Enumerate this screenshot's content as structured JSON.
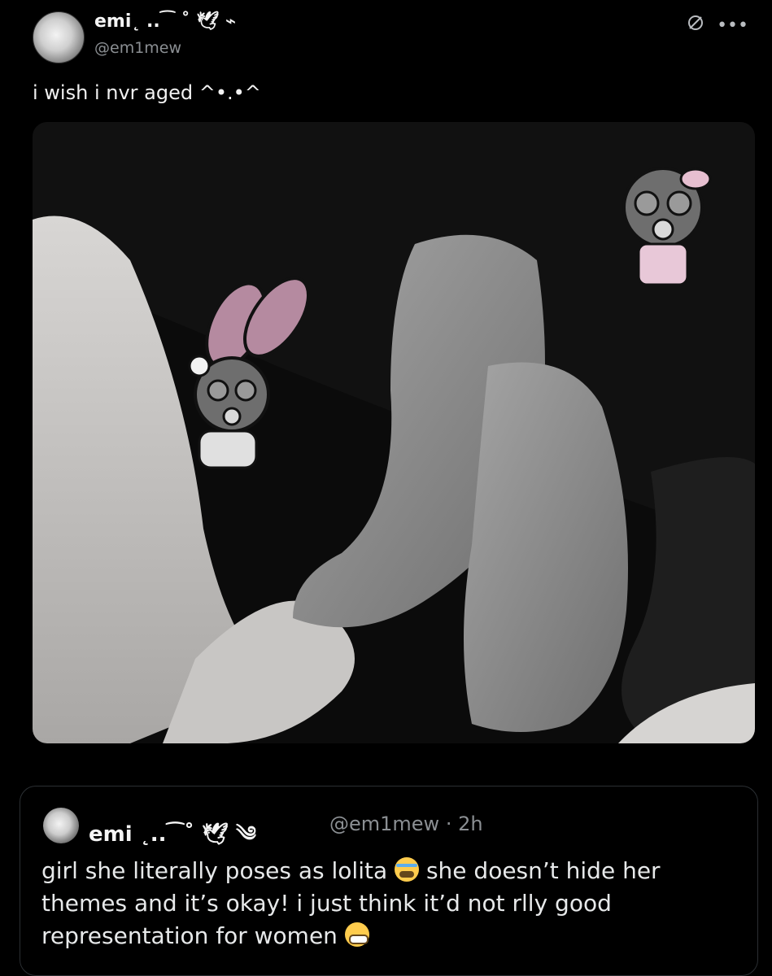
{
  "tweet": {
    "display_name": "emi˛ ..⁀ ˚ 🕊 ⌁",
    "handle": "@em1mew",
    "text": "i wish i nvr aged ^•.•^"
  },
  "quote": {
    "display_name": "emi ˛..⁀˚ 🕊 ༄",
    "handle_time": "@em1mew · 2h",
    "text_a": "girl she literally poses as lolita",
    "text_b": "she doesn’t hide her themes and it’s okay! i just think it’d not rlly good representation for women"
  },
  "icons": {
    "edit": "pen-slash-icon",
    "more": "more-icon"
  }
}
